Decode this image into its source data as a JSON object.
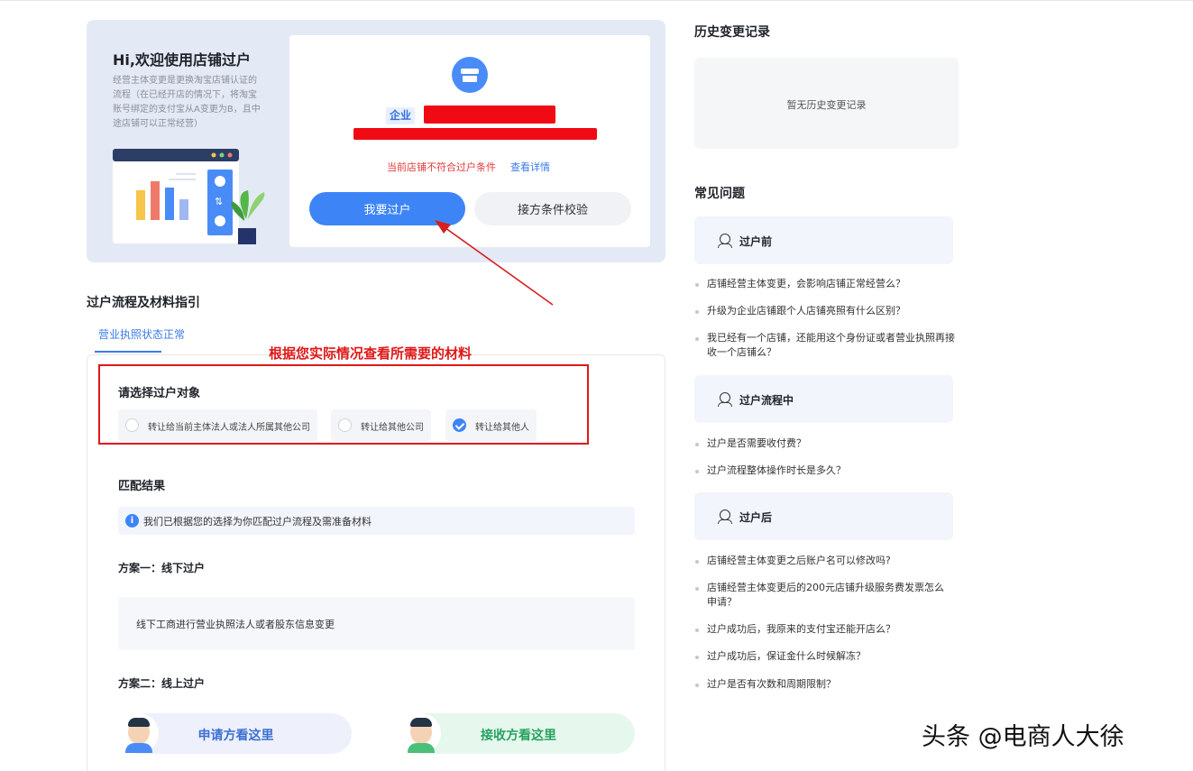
{
  "hero": {
    "title": "Hi,欢迎使用店铺过户",
    "description": "经营主体变更是更换淘宝店铺认证的流程（在已经开店的情况下，将淘宝账号绑定的支付宝从A变更为B，且中途店铺可以正常经营）",
    "enterprise_tag": "企业",
    "condition_text": "当前店铺不符合过户条件",
    "condition_link": "查看详情",
    "primary_button": "我要过户",
    "secondary_button": "接方条件校验"
  },
  "process": {
    "title": "过户流程及材料指引",
    "active_tab": "营业执照状态正常",
    "annotation": "根据您实际情况查看所需要的材料",
    "choose_title": "请选择过户对象",
    "options": [
      {
        "label": "转让给当前主体法人或法人所属其他公司",
        "checked": false
      },
      {
        "label": "转让给其他公司",
        "checked": false
      },
      {
        "label": "转让给其他人",
        "checked": true
      }
    ],
    "match_title": "匹配结果",
    "info_icon": "i",
    "info_text": "我们已根据您的选择为你匹配过户流程及需准备材料",
    "plan1_title": "方案一：线下过户",
    "plan1_text": "线下工商进行营业执照法人或者股东信息变更",
    "plan2_title": "方案二：线上过户",
    "applicant_label": "申请方看这里",
    "receiver_label": "接收方看这里"
  },
  "history": {
    "title": "历史变更记录",
    "empty_text": "暂无历史变更记录"
  },
  "faq": {
    "title": "常见问题",
    "sections": [
      {
        "heading": "过户前",
        "items": [
          "店铺经营主体变更，会影响店铺正常经营么？",
          "升级为企业店铺跟个人店铺亮照有什么区别？",
          "我已经有一个店铺，还能用这个身份证或者营业执照再接收一个店铺么？"
        ]
      },
      {
        "heading": "过户流程中",
        "items": [
          "过户是否需要收付费？",
          "过户流程整体操作时长是多久？"
        ]
      },
      {
        "heading": "过户后",
        "items": [
          "店铺经营主体变更之后账户名可以修改吗?",
          "店铺经营主体变更后的200元店铺升级服务费发票怎么申请？",
          "过户成功后，我原来的支付宝还能开店么？",
          "过户成功后，保证金什么时候解冻？",
          "过户是否有次数和周期限制？"
        ]
      }
    ]
  },
  "watermark": "头条 @电商人大徐",
  "colors": {
    "primary": "#3d85f7",
    "annotation_red": "#e01818",
    "hero_bg": "#e4e9f6"
  }
}
